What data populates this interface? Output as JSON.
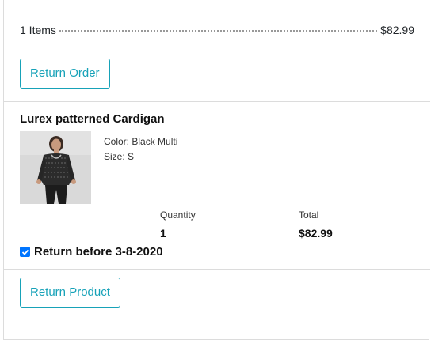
{
  "order_summary": {
    "items_label": "1 Items",
    "total": "$82.99",
    "return_order_label": "Return Order"
  },
  "product": {
    "name": "Lurex patterned Cardigan",
    "color": "Color: Black Multi",
    "size": "Size: S",
    "quantity_label": "Quantity",
    "quantity_value": "1",
    "total_label": "Total",
    "total_value": "$82.99",
    "return_deadline_label": "Return before 3-8-2020",
    "return_deadline_checked": true,
    "return_product_label": "Return Product"
  },
  "colors": {
    "accent": "#17a2b8",
    "checkbox": "#0075ff",
    "divider": "#dcdcdc"
  },
  "icons": {
    "checkbox": "check-icon"
  }
}
